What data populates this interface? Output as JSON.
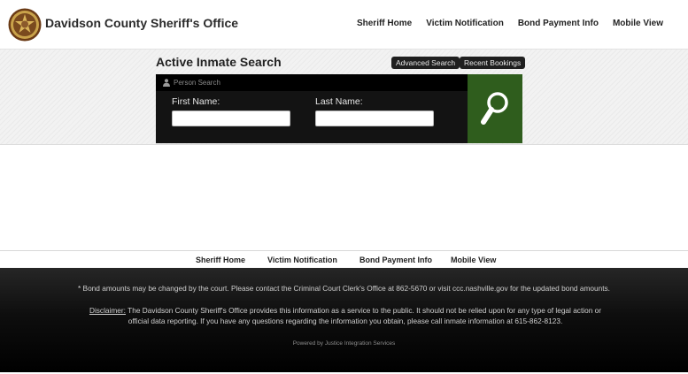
{
  "header": {
    "title": "Davidson County Sheriff's Office",
    "nav": [
      "Sheriff Home",
      "Victim Notification",
      "Bond Payment Info",
      "Mobile View"
    ]
  },
  "search": {
    "title": "Active Inmate Search",
    "advanced_label": "Advanced Search",
    "recent_label": "Recent Bookings",
    "panel_label": "Person Search",
    "first_name_label": "First Name:",
    "last_name_label": "Last Name:",
    "first_name_value": "",
    "last_name_value": ""
  },
  "footer": {
    "nav": [
      "Sheriff Home",
      "Victim Notification",
      "Bond Payment Info",
      "Mobile View"
    ],
    "bond_note": "* Bond amounts may be changed by the court. Please contact the Criminal Court Clerk's Office at 862-5670 or visit ccc.nashville.gov for the updated bond amounts.",
    "disclaimer_label": "Disclaimer:",
    "disclaimer_text": " The Davidson County Sheriff's Office provides this information as a service to the public. It should not be relied upon for any type of legal action or official data reporting. If you have any questions regarding the information you obtain, please call inmate information at 615-862-8123.",
    "powered_by": "Powered by Justice Integration Services"
  },
  "colors": {
    "search_button": "#2f5d1d",
    "panel": "#131313",
    "badge_gold": "#c9a24a",
    "badge_brown": "#6b3b16"
  },
  "icons": {
    "badge": "sheriff-badge-icon",
    "person": "person-icon",
    "search": "magnifier-icon"
  }
}
